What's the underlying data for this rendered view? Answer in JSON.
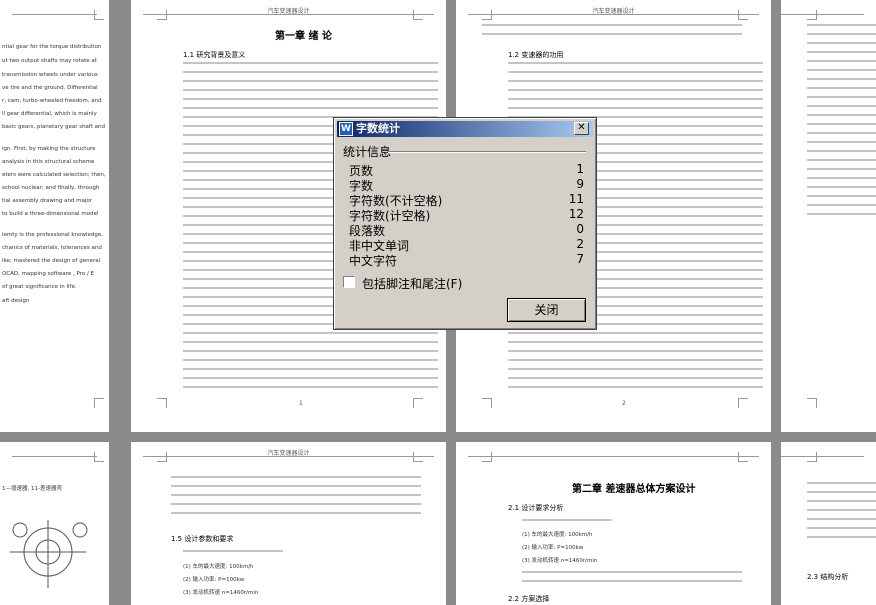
{
  "document": {
    "running_header": "汽车变速器设计",
    "pages_top": [
      {
        "lines_en": [
          "ntial gear for the torque distribution",
          "ut two output shafts may rotate at",
          "transmission wheels under various",
          "ve tire and the ground. Differential",
          "r, cam, turbo-wheeled freedom, and",
          "ll gear differential, which is mainly",
          "basic gears, planetary gear shaft and",
          "",
          "ign. First, by making the structure",
          "analysis in this structural scheme",
          "eters were calculated selection; then,",
          "school nuclear; and finally, through",
          "tial assembly drawing and major",
          "to build a three-dimensional model"
        ],
        "lines_en2": [
          "lemty is the professional knowledge,",
          "chanics of materials, tolerances and",
          "ike; mastered the design of general",
          "OCAD, mapping software , Pro / E",
          "of great significance in life.",
          "aft design"
        ]
      },
      {
        "chapter_title": "第一章 绪 论",
        "section": "1.1 研究背景及意义",
        "page_number": "1"
      },
      {
        "section": "1.2 变速器的功用",
        "page_number": "2"
      },
      {}
    ],
    "pages_bottom": [
      {
        "caption": "1—增速器, 11-差速器壳"
      },
      {
        "section1": "1.5 设计参数和要求",
        "params": [
          "(1) 车的最大速度: 100km/h",
          "(2) 输入功率: P=100kw",
          "(3) 发动机转速 n=1460r/min"
        ]
      },
      {
        "chapter_title": "第二章 差速器总体方案设计",
        "section1": "2.1 设计要求分析",
        "params": [
          "(1) 车的最大速度: 100km/h",
          "(2) 输入功率: P=100kw",
          "(3) 发动机转速 n=1460r/min"
        ],
        "section2": "2.2 方案选择"
      },
      {
        "section": "2.3 结构分析"
      }
    ]
  },
  "dialog": {
    "title": "字数统计",
    "group_label": "统计信息",
    "stats": [
      {
        "label": "页数",
        "value": "1"
      },
      {
        "label": "字数",
        "value": "9"
      },
      {
        "label": "字符数(不计空格)",
        "value": "11"
      },
      {
        "label": "字符数(计空格)",
        "value": "12"
      },
      {
        "label": "段落数",
        "value": "0"
      },
      {
        "label": "非中文单词",
        "value": "2"
      },
      {
        "label": "中文字符",
        "value": "7"
      }
    ],
    "checkbox_label": "包括脚注和尾注(F)",
    "checkbox_checked": false,
    "close_button": "关闭"
  }
}
